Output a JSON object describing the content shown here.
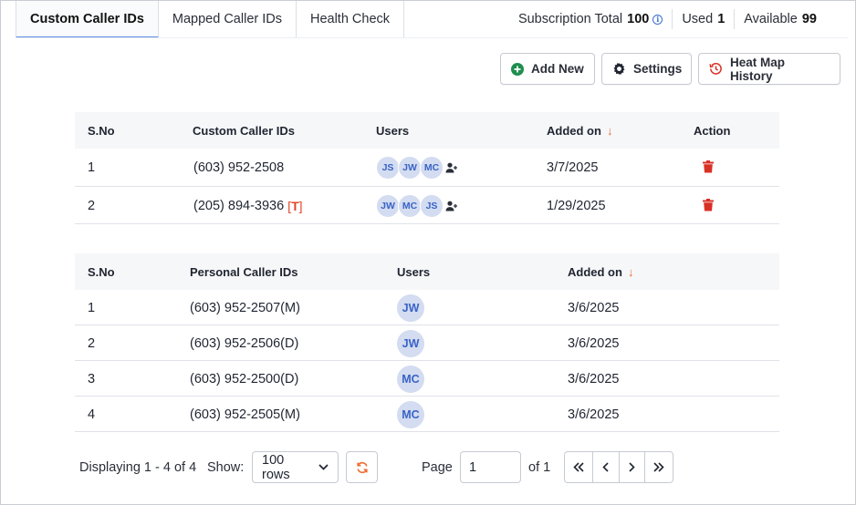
{
  "tabs": [
    {
      "label": "Custom Caller IDs"
    },
    {
      "label": "Mapped Caller IDs"
    },
    {
      "label": "Health Check"
    }
  ],
  "subscription": {
    "total_label": "Subscription Total",
    "total_value": "100",
    "used_label": "Used",
    "used_value": "1",
    "available_label": "Available",
    "available_value": "99"
  },
  "toolbar": {
    "add_new": "Add New",
    "settings": "Settings",
    "heat_map_history": "Heat Map History"
  },
  "custom_table": {
    "headers": {
      "sno": "S.No",
      "caller_ids": "Custom Caller IDs",
      "users": "Users",
      "added_on": "Added on",
      "action": "Action"
    },
    "rows": [
      {
        "sno": "1",
        "caller_id": "(603) 952-2508",
        "tag": "",
        "users": [
          "JS",
          "JW",
          "MC"
        ],
        "added_on": "3/7/2025"
      },
      {
        "sno": "2",
        "caller_id": "(205) 894-3936",
        "tag": "T",
        "users": [
          "JW",
          "MC",
          "JS"
        ],
        "added_on": "1/29/2025"
      }
    ]
  },
  "personal_table": {
    "headers": {
      "sno": "S.No",
      "caller_ids": "Personal Caller IDs",
      "users": "Users",
      "added_on": "Added on"
    },
    "rows": [
      {
        "sno": "1",
        "caller_id": "(603) 952-2507(M)",
        "user": "JW",
        "added_on": "3/6/2025"
      },
      {
        "sno": "2",
        "caller_id": "(603) 952-2506(D)",
        "user": "JW",
        "added_on": "3/6/2025"
      },
      {
        "sno": "3",
        "caller_id": "(603) 952-2500(D)",
        "user": "MC",
        "added_on": "3/6/2025"
      },
      {
        "sno": "4",
        "caller_id": "(603) 952-2505(M)",
        "user": "MC",
        "added_on": "3/6/2025"
      }
    ]
  },
  "footer": {
    "displaying": "Displaying 1 - 4 of 4",
    "show_label": "Show:",
    "rows_option": "100 rows",
    "page_label": "Page",
    "page_value": "1",
    "of_label": "of 1"
  },
  "icons": {
    "add": "plus-circle-icon",
    "settings": "gear-icon",
    "history": "history-icon",
    "delete": "trash-icon",
    "refresh": "refresh-icon",
    "info": "info-icon"
  },
  "colors": {
    "accent": "#5b8ee6",
    "sort_arrow": "#ee6a2f",
    "delete": "#d93025",
    "add_icon": "#1e8e4e",
    "avatar_bg": "#d3dcf0",
    "avatar_text": "#3a63c7",
    "refresh": "#ee6a2f",
    "history": "#d93025"
  }
}
